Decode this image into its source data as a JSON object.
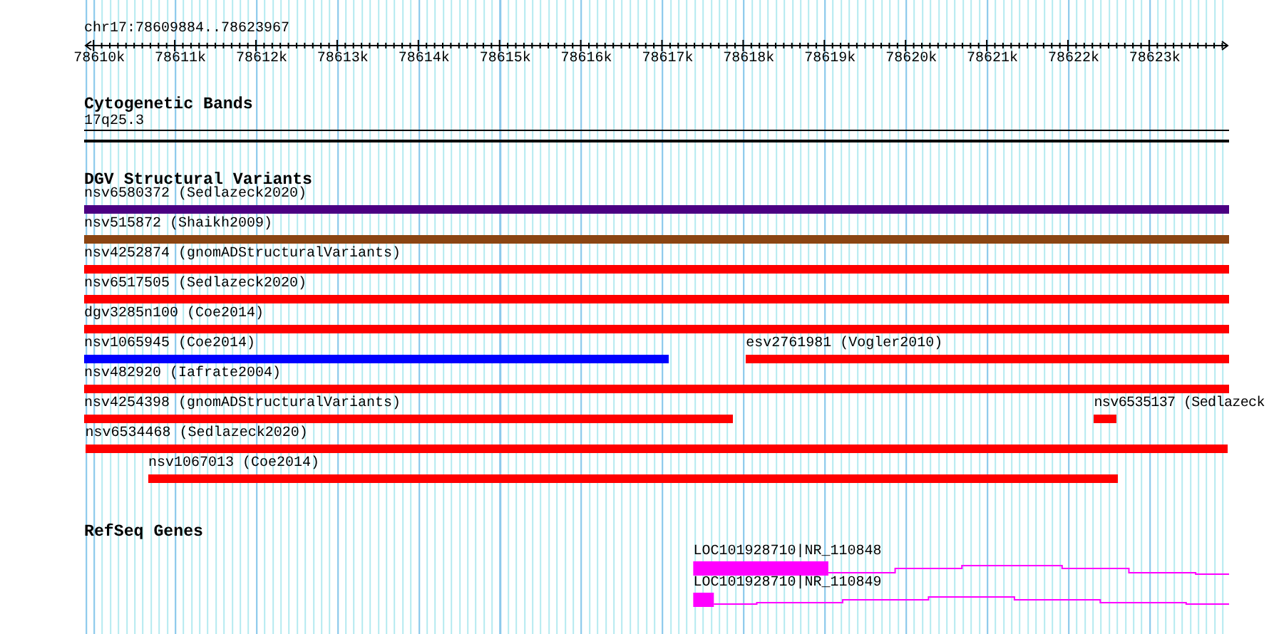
{
  "ruler": {
    "title": "chr17:78609884..78623967",
    "ticks": [
      "78610k",
      "78611k",
      "78612k",
      "78613k",
      "78614k",
      "78615k",
      "78616k",
      "78617k",
      "78618k",
      "78619k",
      "78620k",
      "78621k",
      "78622k",
      "78623k"
    ]
  },
  "tracks": [
    {
      "kind": "bands",
      "title": "Cytogenetic Bands",
      "label": "17q25.3"
    },
    {
      "kind": "variants",
      "title": "DGV Structural Variants",
      "rows": [
        {
          "features": [
            {
              "label": "nsv6580372 (Sedlazeck2020)",
              "color": "#4b0082"
            }
          ]
        },
        {
          "features": [
            {
              "label": "nsv515872 (Shaikh2009)",
              "color": "#8b4513"
            }
          ]
        },
        {
          "features": [
            {
              "label": "nsv4252874 (gnomADStructuralVariants)",
              "color": "#ff0000"
            }
          ]
        },
        {
          "features": [
            {
              "label": "nsv6517505 (Sedlazeck2020)",
              "color": "#ff0000"
            }
          ]
        },
        {
          "features": [
            {
              "label": "dgv3285n100 (Coe2014)",
              "color": "#ff0000"
            }
          ]
        },
        {
          "features": [
            {
              "label": "nsv1065945 (Coe2014)",
              "color": "#0000ff"
            },
            {
              "label": "esv2761981 (Vogler2010)",
              "color": "#ff0000"
            }
          ]
        },
        {
          "features": [
            {
              "label": "nsv482920 (Iafrate2004)",
              "color": "#ff0000"
            }
          ]
        },
        {
          "features": [
            {
              "label": "nsv4254398 (gnomADStructuralVariants)",
              "color": "#ff0000"
            },
            {
              "label": "nsv6535137 (Sedlazeck",
              "color": "#ff0000"
            }
          ]
        },
        {
          "features": [
            {
              "label": "nsv6534468 (Sedlazeck2020)",
              "color": "#ff0000"
            }
          ]
        },
        {
          "features": [
            {
              "label": "nsv1067013 (Coe2014)",
              "color": "#ff0000"
            }
          ]
        }
      ]
    },
    {
      "kind": "genes",
      "title": "RefSeq Genes",
      "genes": [
        {
          "label": "LOC101928710|NR_110848",
          "color": "#ff00ff"
        },
        {
          "label": "LOC101928710|NR_110849",
          "color": "#ff00ff"
        }
      ]
    }
  ]
}
